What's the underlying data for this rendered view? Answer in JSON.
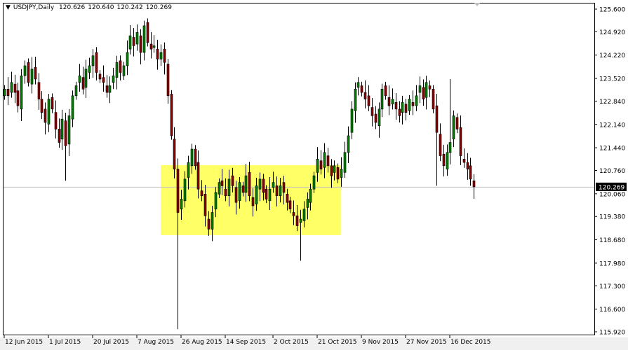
{
  "header": {
    "symbol": "USDJPY,Daily",
    "open": "120.626",
    "high": "120.640",
    "low": "120.242",
    "close": "120.269"
  },
  "colors": {
    "bull": "#008000",
    "bear": "#8b0000",
    "rectangle": "#ffff66",
    "price_line": "#c0c0c0",
    "price_label_bg": "#000000"
  },
  "chart_data": {
    "type": "candlestick",
    "title": "USDJPY,Daily",
    "current_price": "120.269",
    "ylim": [
      115.92,
      125.6
    ],
    "y_ticks": [
      "125.600",
      "124.920",
      "124.220",
      "123.520",
      "122.840",
      "122.140",
      "121.440",
      "120.760",
      "120.060",
      "119.380",
      "118.680",
      "117.980",
      "117.300",
      "116.600",
      "115.920"
    ],
    "x_labels": [
      {
        "index": 0,
        "text": "12 Jun 2015"
      },
      {
        "index": 13,
        "text": "1 Jul 2015"
      },
      {
        "index": 26,
        "text": "20 Jul 2015"
      },
      {
        "index": 39,
        "text": "7 Aug 2015"
      },
      {
        "index": 52,
        "text": "26 Aug 2015"
      },
      {
        "index": 65,
        "text": "14 Sep 2015"
      },
      {
        "index": 79,
        "text": "2 Oct 2015"
      },
      {
        "index": 92,
        "text": "21 Oct 2015"
      },
      {
        "index": 105,
        "text": "9 Nov 2015"
      },
      {
        "index": 118,
        "text": "27 Nov 2015"
      },
      {
        "index": 131,
        "text": "16 Dec 2015"
      }
    ],
    "closes": [
      123.2,
      123.0,
      123.4,
      123.1,
      122.7,
      123.6,
      123.9,
      123.4,
      123.8,
      123.5,
      122.9,
      122.5,
      122.2,
      122.9,
      122.6,
      122.0,
      121.6,
      122.3,
      121.5,
      122.4,
      123.0,
      123.3,
      123.6,
      123.2,
      123.8,
      123.9,
      124.2,
      123.7,
      123.5,
      123.4,
      123.1,
      123.3,
      123.6,
      124.0,
      123.7,
      123.9,
      124.3,
      124.8,
      124.5,
      124.9,
      124.3,
      125.1,
      124.6,
      124.4,
      124.5,
      124.1,
      124.3,
      124.0,
      123.0,
      121.8,
      120.8,
      119.5,
      119.9,
      120.5,
      121.0,
      121.4,
      120.9,
      120.2,
      120.0,
      119.4,
      119.0,
      119.5,
      120.1,
      120.4,
      120.3,
      120.0,
      120.5,
      120.3,
      119.8,
      120.4,
      120.1,
      120.6,
      120.0,
      119.7,
      120.3,
      120.5,
      120.1,
      119.9,
      120.2,
      120.4,
      120.0,
      120.3,
      120.1,
      119.8,
      119.6,
      119.4,
      119.1,
      119.3,
      119.6,
      119.9,
      120.2,
      120.6,
      121.1,
      120.8,
      121.3,
      120.9,
      120.6,
      120.9,
      120.5,
      120.8,
      121.3,
      121.8,
      122.6,
      123.2,
      123.4,
      123.1,
      122.9,
      122.7,
      122.4,
      122.2,
      122.6,
      123.2,
      123.0,
      122.7,
      122.9,
      122.6,
      122.4,
      122.8,
      122.5,
      122.9,
      122.7,
      123.0,
      123.3,
      122.9,
      123.4,
      123.2,
      122.6,
      121.9,
      121.2,
      120.9,
      121.3,
      121.6,
      122.4,
      122.0,
      121.2,
      121.0,
      120.8,
      120.5,
      120.269
    ],
    "wick_extremes": [
      {
        "index": 18,
        "low": 120.45
      },
      {
        "index": 51,
        "low": 116.0
      },
      {
        "index": 41,
        "high": 125.25
      },
      {
        "index": 87,
        "low": 118.05
      },
      {
        "index": 131,
        "high": 123.5
      },
      {
        "index": 127,
        "low": 120.3
      }
    ],
    "rectangle": {
      "from_index": 46,
      "to_index": 99,
      "price_low": 118.82,
      "price_high": 120.92
    }
  }
}
